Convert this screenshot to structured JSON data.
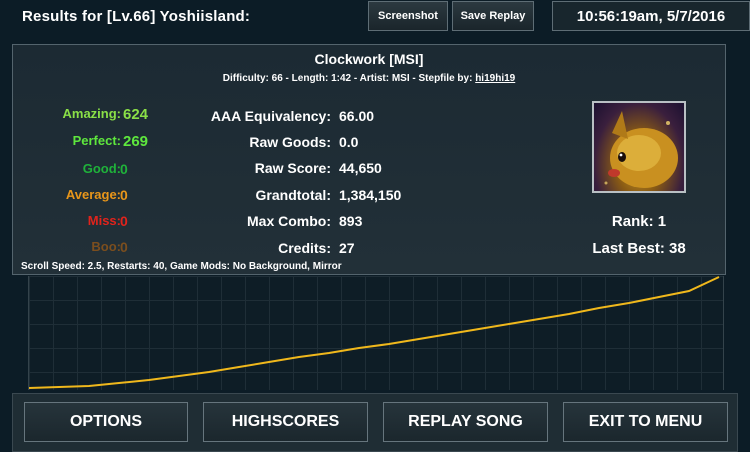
{
  "header": {
    "title": "Results for [Lv.66] Yoshiisland:",
    "screenshot_label": "Screenshot",
    "save_replay_label": "Save Replay",
    "clock": "10:56:19am, 5/7/2016"
  },
  "song": {
    "title": "Clockwork [MSI]",
    "meta_prefix": "Difficulty: 66 - Length: 1:42 - Artist: MSI - Stepfile by:",
    "stepfile_by": "hi19hi19"
  },
  "judgements": [
    {
      "label": "Amazing:",
      "value": "624",
      "color": "#8ae047"
    },
    {
      "label": "Perfect:",
      "value": "269",
      "color": "#5ee73d"
    },
    {
      "label": "Good:",
      "value": "0",
      "color": "#1fb23a"
    },
    {
      "label": "Average:",
      "value": "0",
      "color": "#e8961a"
    },
    {
      "label": "Miss:",
      "value": "0",
      "color": "#e0231c"
    },
    {
      "label": "Boo:",
      "value": "0",
      "color": "#7b4e1e"
    }
  ],
  "stats": [
    {
      "label": "AAA Equivalency:",
      "value": "66.00"
    },
    {
      "label": "Raw Goods:",
      "value": "0.0"
    },
    {
      "label": "Raw Score:",
      "value": "44,650"
    },
    {
      "label": "Grandtotal:",
      "value": "1,384,150"
    },
    {
      "label": "Max Combo:",
      "value": "893"
    },
    {
      "label": "Credits:",
      "value": "27"
    }
  ],
  "rank": {
    "rank_text": "Rank: 1",
    "last_best_text": "Last Best: 38"
  },
  "scroll_info": "Scroll Speed: 2.5, Restarts: 40, Game Mods: No Background, Mirror",
  "buttons": {
    "options": "OPTIONS",
    "highscores": "HIGHSCORES",
    "replay": "REPLAY SONG",
    "exit": "EXIT TO MENU"
  },
  "colors": {
    "graph_line": "#f0b81c",
    "background": "#0c1c26"
  }
}
